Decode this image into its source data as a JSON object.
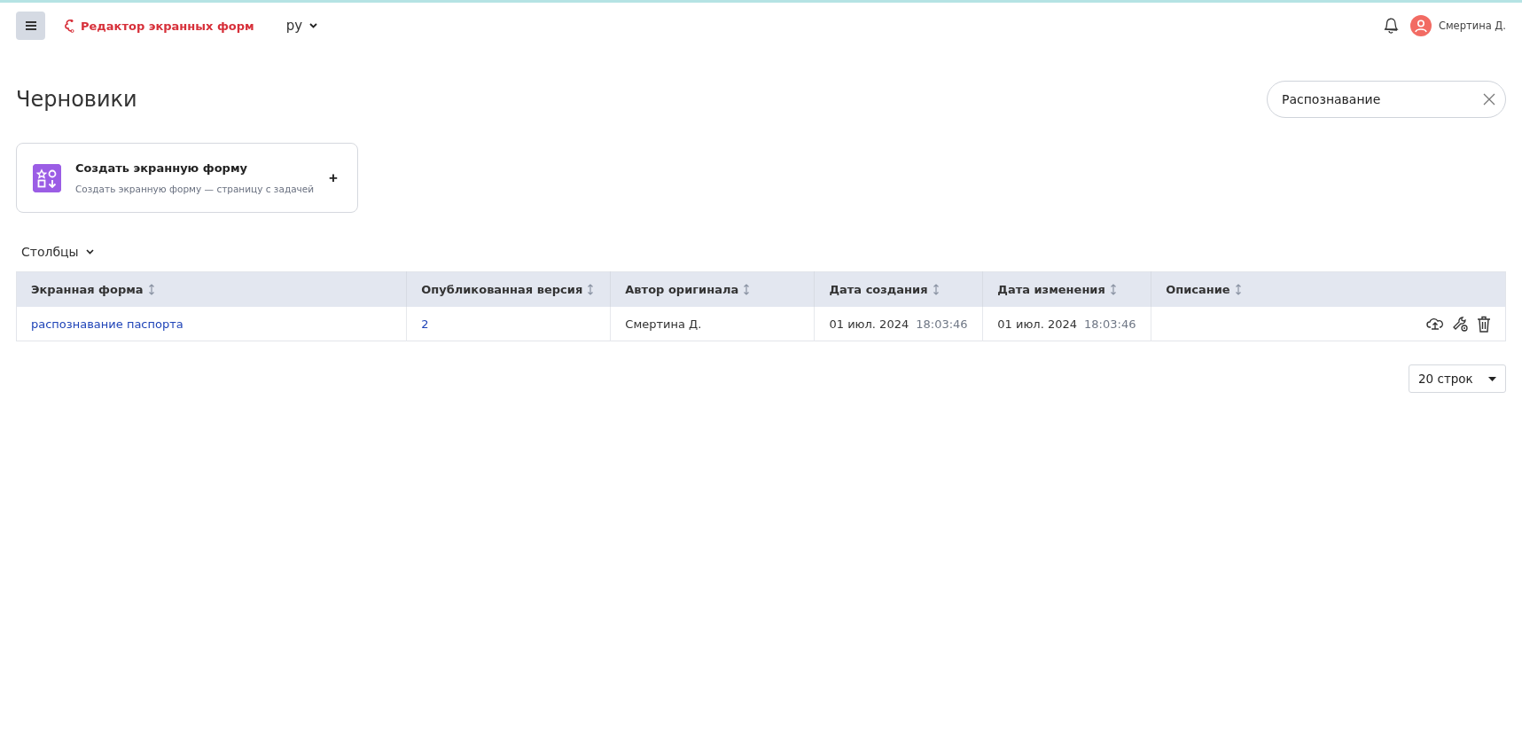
{
  "header": {
    "app_title": "Редактор экранных форм",
    "language": "ру",
    "user_name": "Смертина Д."
  },
  "page": {
    "title": "Черновики",
    "search": {
      "value": "Распознавание"
    }
  },
  "create_card": {
    "title": "Создать экранную форму",
    "subtitle": "Создать экранную форму — страницу с задачей",
    "action": "+"
  },
  "columns_toggle": "Столбцы",
  "table": {
    "columns": [
      {
        "label": "Экранная форма"
      },
      {
        "label": "Опубликованная версия"
      },
      {
        "label": "Автор оригинала"
      },
      {
        "label": "Дата создания"
      },
      {
        "label": "Дата изменения"
      },
      {
        "label": "Описание"
      }
    ],
    "rows": [
      {
        "form": "распознавание паспорта",
        "version": "2",
        "author": "Смертина Д.",
        "created_date": "01 июл. 2024",
        "created_time": "18:03:46",
        "modified_date": "01 июл. 2024",
        "modified_time": "18:03:46"
      }
    ]
  },
  "pagination": {
    "rows_per_page": "20 строк"
  }
}
